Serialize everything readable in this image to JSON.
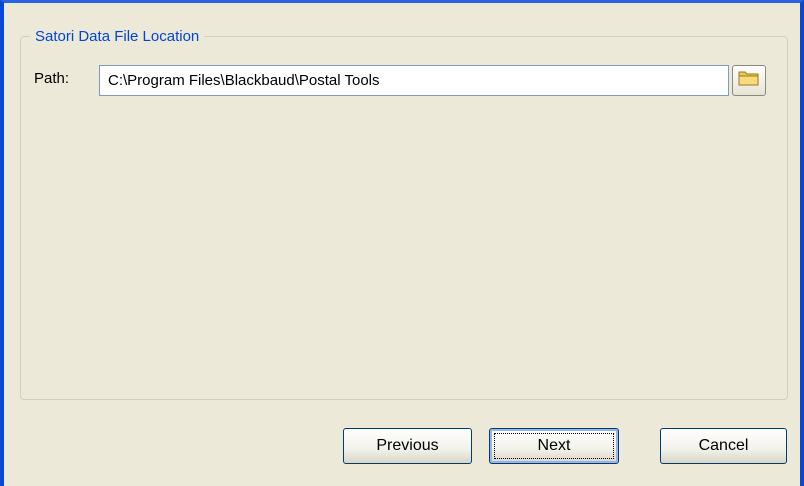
{
  "group": {
    "title": "Satori Data File Location"
  },
  "path": {
    "label": "Path:",
    "value": "C:\\Program Files\\Blackbaud\\Postal Tools"
  },
  "buttons": {
    "previous": "Previous",
    "next": "Next",
    "cancel": "Cancel"
  },
  "icons": {
    "browse": "folder-icon"
  },
  "colors": {
    "window_border": "#0a46d9",
    "group_title": "#0046d5",
    "background": "#ece9d8"
  }
}
